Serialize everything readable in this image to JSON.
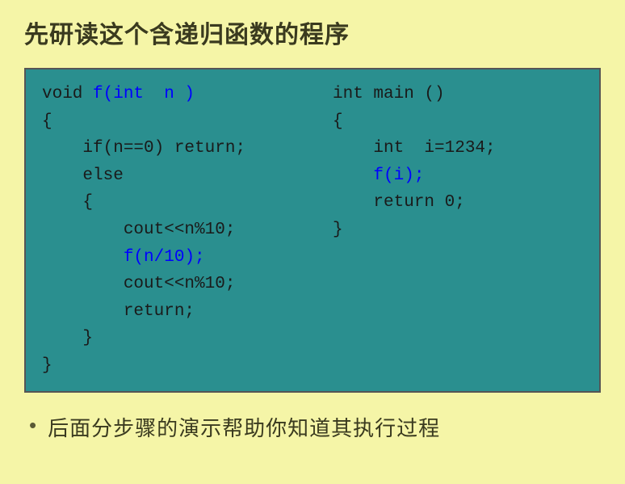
{
  "title": "先研读这个含递归函数的程序",
  "code_left": {
    "l1a": "void ",
    "l1b": "f(int  n )",
    "l2": "{",
    "l3": "    if(n==0) return;",
    "l4": "    else",
    "l5": "    {",
    "l6": "        cout<<n%10;",
    "l7a": "        ",
    "l7b": "f(n/10);",
    "l8": "        cout<<n%10;",
    "l9": "        return;",
    "l10": "    }",
    "l11": "}"
  },
  "code_right": {
    "l1": "int main ()",
    "l2": "{",
    "l3": "    int  i=1234;",
    "l4a": "    ",
    "l4b": "f(i);",
    "l5": "    return 0;",
    "l6": "}"
  },
  "bullet": "后面分步骤的演示帮助你知道其执行过程"
}
